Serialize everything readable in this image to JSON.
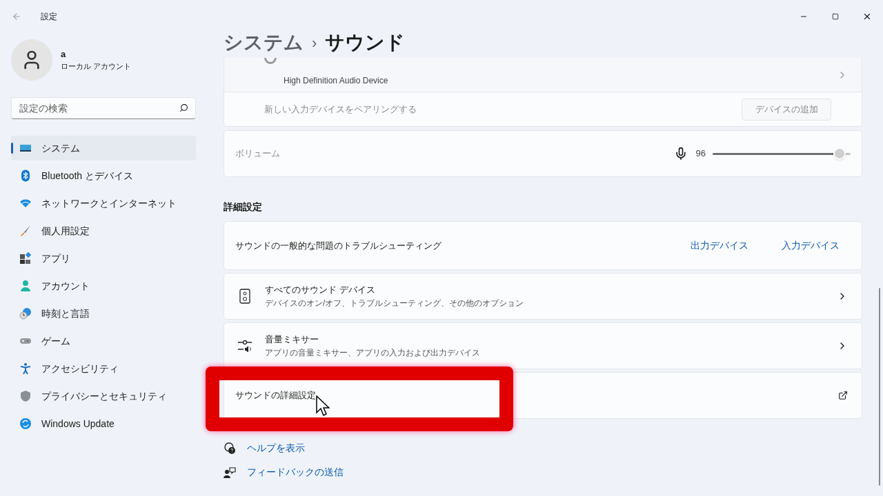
{
  "window": {
    "title": "設定"
  },
  "profile": {
    "name": "a",
    "account": "ローカル アカウント"
  },
  "search": {
    "placeholder": "設定の検索"
  },
  "nav": [
    {
      "label": "システム",
      "kind": "system",
      "selected": true
    },
    {
      "label": "Bluetooth とデバイス",
      "kind": "bluetooth",
      "selected": false
    },
    {
      "label": "ネットワークとインターネット",
      "kind": "network",
      "selected": false
    },
    {
      "label": "個人用設定",
      "kind": "brush",
      "selected": false
    },
    {
      "label": "アプリ",
      "kind": "apps",
      "selected": false
    },
    {
      "label": "アカウント",
      "kind": "account",
      "selected": false
    },
    {
      "label": "時刻と言語",
      "kind": "time",
      "selected": false
    },
    {
      "label": "ゲーム",
      "kind": "game",
      "selected": false
    },
    {
      "label": "アクセシビリティ",
      "kind": "access",
      "selected": false
    },
    {
      "label": "プライバシーとセキュリティ",
      "kind": "shield",
      "selected": false
    },
    {
      "label": "Windows Update",
      "kind": "update",
      "selected": false
    }
  ],
  "breadcrumb": {
    "parent": "システム",
    "separator": "›",
    "current": "サウンド"
  },
  "input_device": {
    "subtitle": "High Definition Audio Device"
  },
  "pair": {
    "label": "新しい入力デバイスをペアリングする",
    "button": "デバイスの追加"
  },
  "volume": {
    "label": "ボリューム",
    "reading": "96",
    "level": 0.96
  },
  "advanced": {
    "heading": "詳細設定",
    "troubleshoot": {
      "label": "サウンドの一般的な問題のトラブルシューティング",
      "links": [
        "出力デバイス",
        "入力デバイス"
      ]
    },
    "rows": [
      {
        "kind": "speaker",
        "title": "すべてのサウンド デバイス",
        "subtitle": "デバイスのオン/オフ、トラブルシューティング、その他のオプション"
      },
      {
        "kind": "mixer",
        "title": "音量ミキサー",
        "subtitle": "アプリの音量ミキサー、アプリの入力および出力デバイス"
      },
      {
        "kind": "external",
        "title": "サウンドの詳細設定"
      }
    ]
  },
  "footer_links": [
    {
      "kind": "help",
      "label": "ヘルプを表示"
    },
    {
      "kind": "feedback",
      "label": "フィードバックの送信"
    }
  ]
}
